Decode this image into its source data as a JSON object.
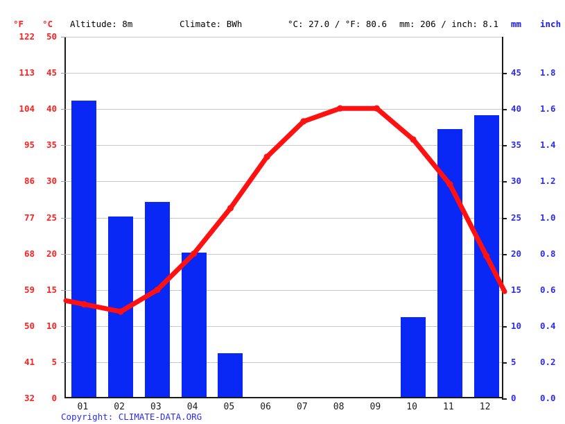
{
  "header": {
    "unit_f": "°F",
    "unit_c": "°C",
    "altitude": "Altitude: 8m",
    "climate": "Climate: BWh",
    "temperature": "°C: 27.0 / °F: 80.6",
    "precipitation": "mm: 206 / inch: 8.1",
    "unit_mm": "mm",
    "unit_inch": "inch"
  },
  "copyright": "Copyright: CLIMATE-DATA.ORG",
  "colors": {
    "temperature_line": "#ff1111",
    "precipitation_bar": "#0a28f5",
    "left_axis_text": "#ff2020",
    "right_axis_text": "#2b2bf5",
    "gridline": "#c8c8c8",
    "axis": "#1a1a1a"
  },
  "axes": {
    "left_f_ticks": [
      "122",
      "113",
      "104",
      "95",
      "86",
      "77",
      "68",
      "59",
      "50",
      "41",
      "32"
    ],
    "left_c_ticks": [
      "50",
      "45",
      "40",
      "35",
      "30",
      "25",
      "20",
      "15",
      "10",
      "5",
      "0"
    ],
    "right_mm_ticks": [
      "45",
      "40",
      "35",
      "30",
      "25",
      "20",
      "15",
      "10",
      "5",
      "0"
    ],
    "right_inch_ticks": [
      "1.8",
      "1.6",
      "1.4",
      "1.2",
      "1.0",
      "0.8",
      "0.6",
      "0.4",
      "0.2",
      "0.0"
    ]
  },
  "chart_data": {
    "type": "bar",
    "title": "",
    "subtitle": "",
    "xlabel": "",
    "ylabel": "",
    "grid": true,
    "legend": "none",
    "categories": [
      "01",
      "02",
      "03",
      "04",
      "05",
      "06",
      "07",
      "08",
      "09",
      "10",
      "11",
      "12"
    ],
    "series": [
      {
        "name": "Precipitation",
        "type": "bar",
        "unit": "mm",
        "axis": "right",
        "color": "#0a28f5",
        "values": [
          41,
          25,
          27,
          20,
          6,
          0,
          0,
          0,
          0,
          11,
          37,
          39
        ]
      },
      {
        "name": "Temperature",
        "type": "line",
        "unit": "°C",
        "axis": "left",
        "color": "#ff1111",
        "values": [
          13.0,
          12.0,
          15.0,
          20.0,
          26.3,
          33.4,
          38.3,
          40.1,
          40.1,
          35.8,
          29.6,
          19.7
        ]
      }
    ],
    "left_axis_c_range": [
      0,
      50
    ],
    "left_axis_f_range": [
      32,
      122
    ],
    "right_axis_mm_range": [
      0,
      48
    ],
    "right_axis_inch_range": [
      0.0,
      1.9
    ]
  },
  "months": [
    "01",
    "02",
    "03",
    "04",
    "05",
    "06",
    "07",
    "08",
    "09",
    "10",
    "11",
    "12"
  ]
}
